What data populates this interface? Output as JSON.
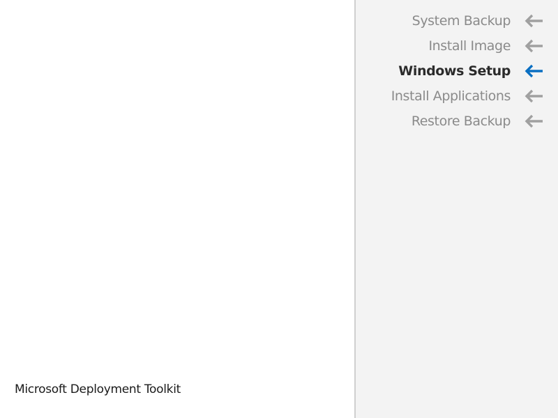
{
  "brand": {
    "name": "Microsoft Deployment Toolkit"
  },
  "steps": {
    "items": [
      {
        "label": "System Backup",
        "state": "inactive",
        "icon": "arrow-left-icon"
      },
      {
        "label": "Install Image",
        "state": "inactive",
        "icon": "arrow-left-icon"
      },
      {
        "label": "Windows Setup",
        "state": "active",
        "icon": "arrow-left-icon"
      },
      {
        "label": "Install Applications",
        "state": "inactive",
        "icon": "arrow-left-icon"
      },
      {
        "label": "Restore Backup",
        "state": "inactive",
        "icon": "arrow-left-icon"
      }
    ]
  },
  "colors": {
    "active_arrow": "#0a6fc2",
    "inactive_arrow": "#a0a0a0",
    "sidebar_bg": "#f3f3f3",
    "active_text": "#2b2b2b",
    "inactive_text": "#8a8a8a"
  }
}
